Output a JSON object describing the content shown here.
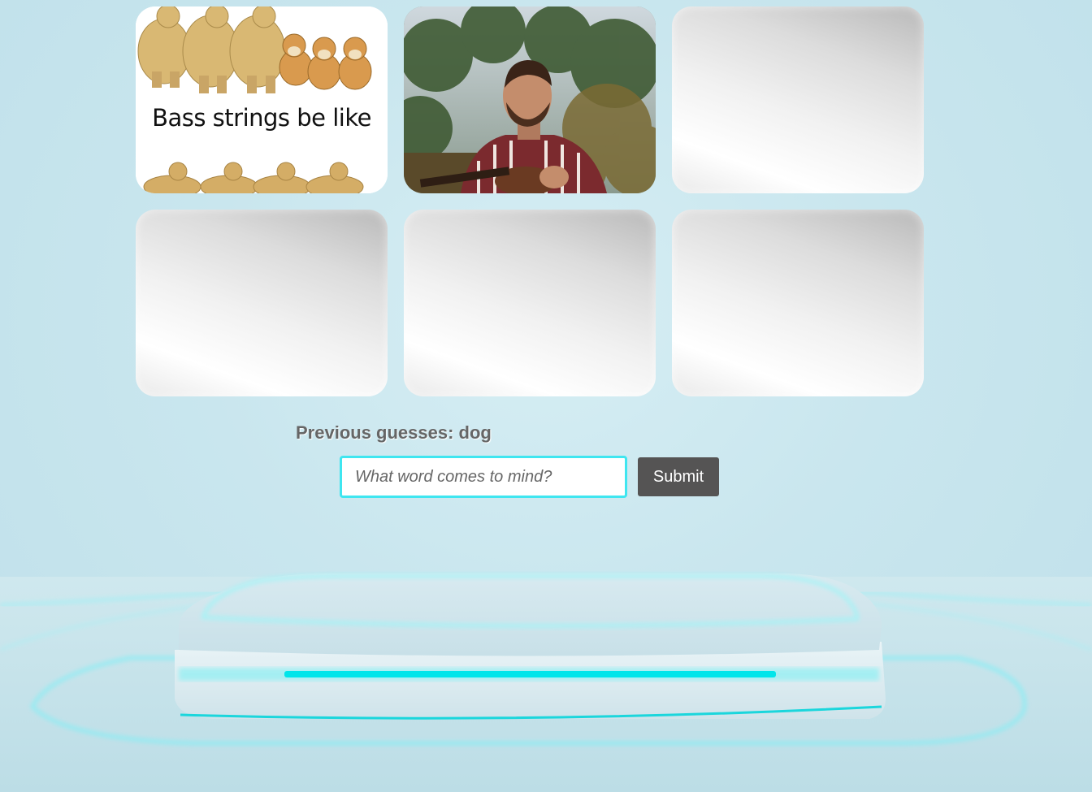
{
  "tiles": [
    {
      "caption": "Bass strings be  like"
    },
    {},
    {},
    {},
    {},
    {}
  ],
  "previous_guesses": "Previous guesses: dog",
  "guess_input": {
    "placeholder": "What word comes to mind?",
    "value": ""
  },
  "submit_label": "Submit",
  "colors": {
    "input_border": "#3fe6f0",
    "button_bg": "#555454",
    "podium_glow": "#00e5ea"
  }
}
